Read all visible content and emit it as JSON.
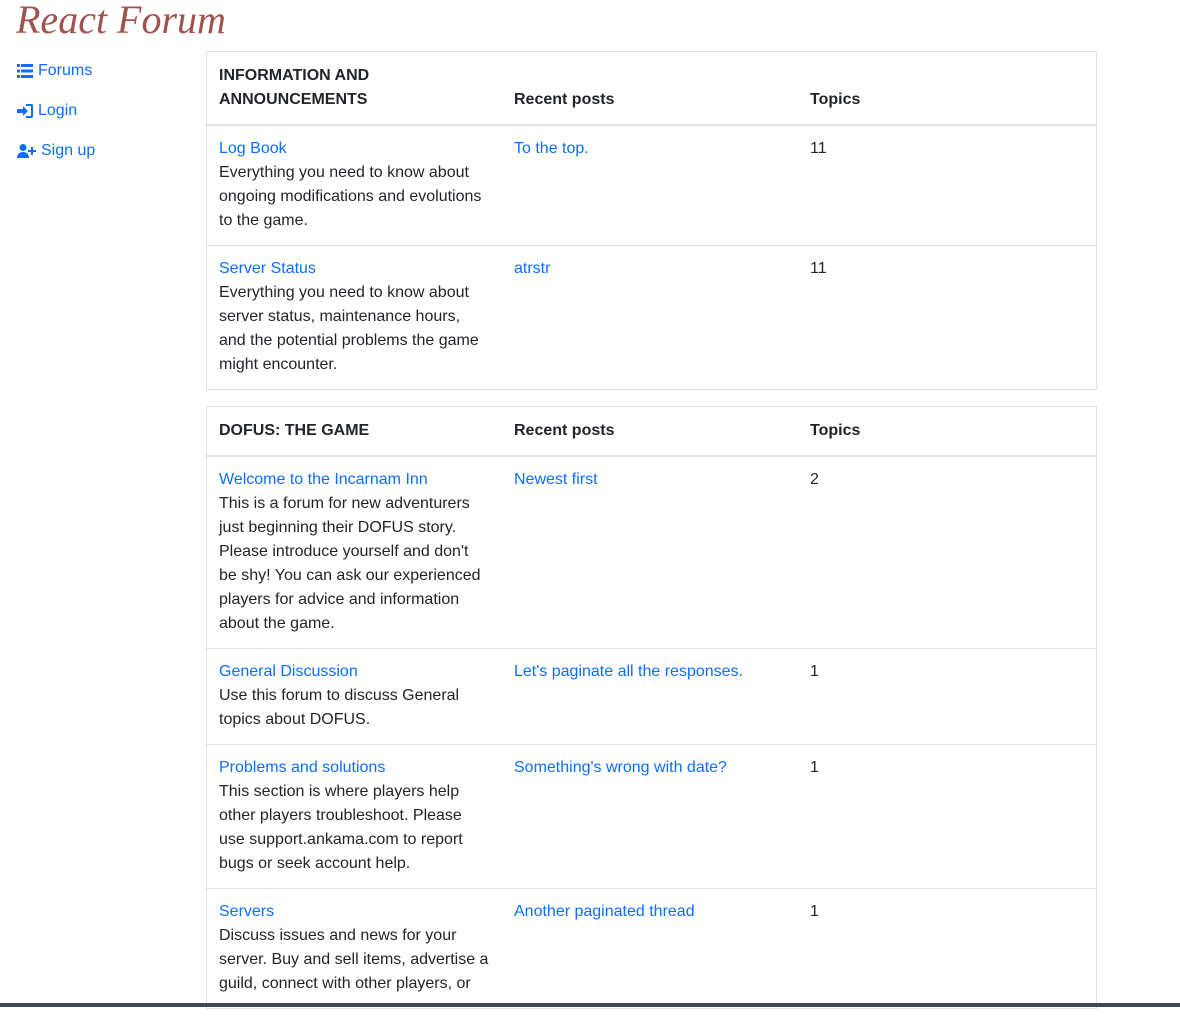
{
  "site": {
    "title": "React Forum"
  },
  "nav": {
    "items": [
      {
        "label": "Forums",
        "icon": "list-icon"
      },
      {
        "label": "Login",
        "icon": "sign-in-icon"
      },
      {
        "label": "Sign up",
        "icon": "user-plus-icon"
      }
    ]
  },
  "sections": [
    {
      "title": "INFORMATION AND ANNOUNCEMENTS",
      "recent_header": "Recent posts",
      "topics_header": "Topics",
      "forums": [
        {
          "name": "Log Book",
          "description": "Everything you need to know about ongoing modifications and evolutions to the game.",
          "recent": "To the top.",
          "topics": "11"
        },
        {
          "name": "Server Status",
          "description": "Everything you need to know about server status, maintenance hours, and the potential problems the game might encounter.",
          "recent": "atrstr",
          "topics": "11"
        }
      ]
    },
    {
      "title": "DOFUS: THE GAME",
      "recent_header": "Recent posts",
      "topics_header": "Topics",
      "forums": [
        {
          "name": "Welcome to the Incarnam Inn",
          "description": "This is a forum for new adventurers just beginning their DOFUS story. Please introduce yourself and don't be shy! You can ask our experienced players for advice and information about the game.",
          "recent": "Newest first",
          "topics": "2"
        },
        {
          "name": "General Discussion",
          "description": "Use this forum to discuss General topics about DOFUS.",
          "recent": "Let's paginate all the responses.",
          "topics": "1"
        },
        {
          "name": "Problems and solutions",
          "description": "This section is where players help other players troubleshoot. Please use support.ankama.com to report bugs or seek account help.",
          "recent": "Something's wrong with date?",
          "topics": "1"
        },
        {
          "name": "Servers",
          "description": "Discuss issues and news for your server. Buy and sell items, advertise a guild, connect with other players, or",
          "recent": "Another paginated thread",
          "topics": "1"
        }
      ]
    }
  ]
}
